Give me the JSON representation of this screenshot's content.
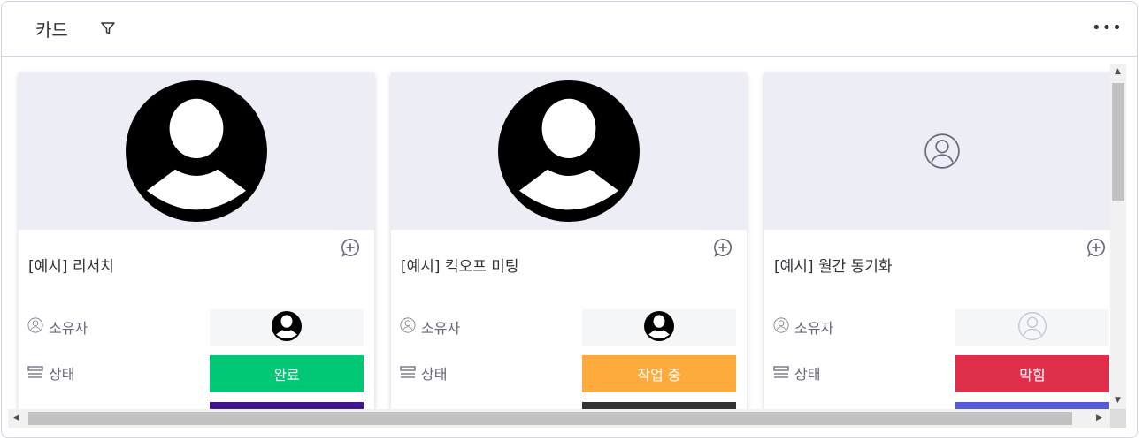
{
  "header": {
    "title": "카드",
    "more_label": "•••"
  },
  "labels": {
    "owner": "소유자",
    "status": "상태"
  },
  "cards": [
    {
      "title": "[예시] 리서치",
      "cover": "avatar-filled",
      "owner": "filled",
      "status": "완료",
      "status_color": "#00c875",
      "next_color": "#401694"
    },
    {
      "title": "[예시] 킥오프 미팅",
      "cover": "avatar-filled",
      "owner": "filled",
      "status": "작업 중",
      "status_color": "#fdab3d",
      "next_color": "#333333"
    },
    {
      "title": "[예시] 월간 동기화",
      "cover": "avatar-empty",
      "owner": "empty",
      "status": "막힘",
      "status_color": "#df2f4a",
      "next_color": "#5559df"
    }
  ]
}
